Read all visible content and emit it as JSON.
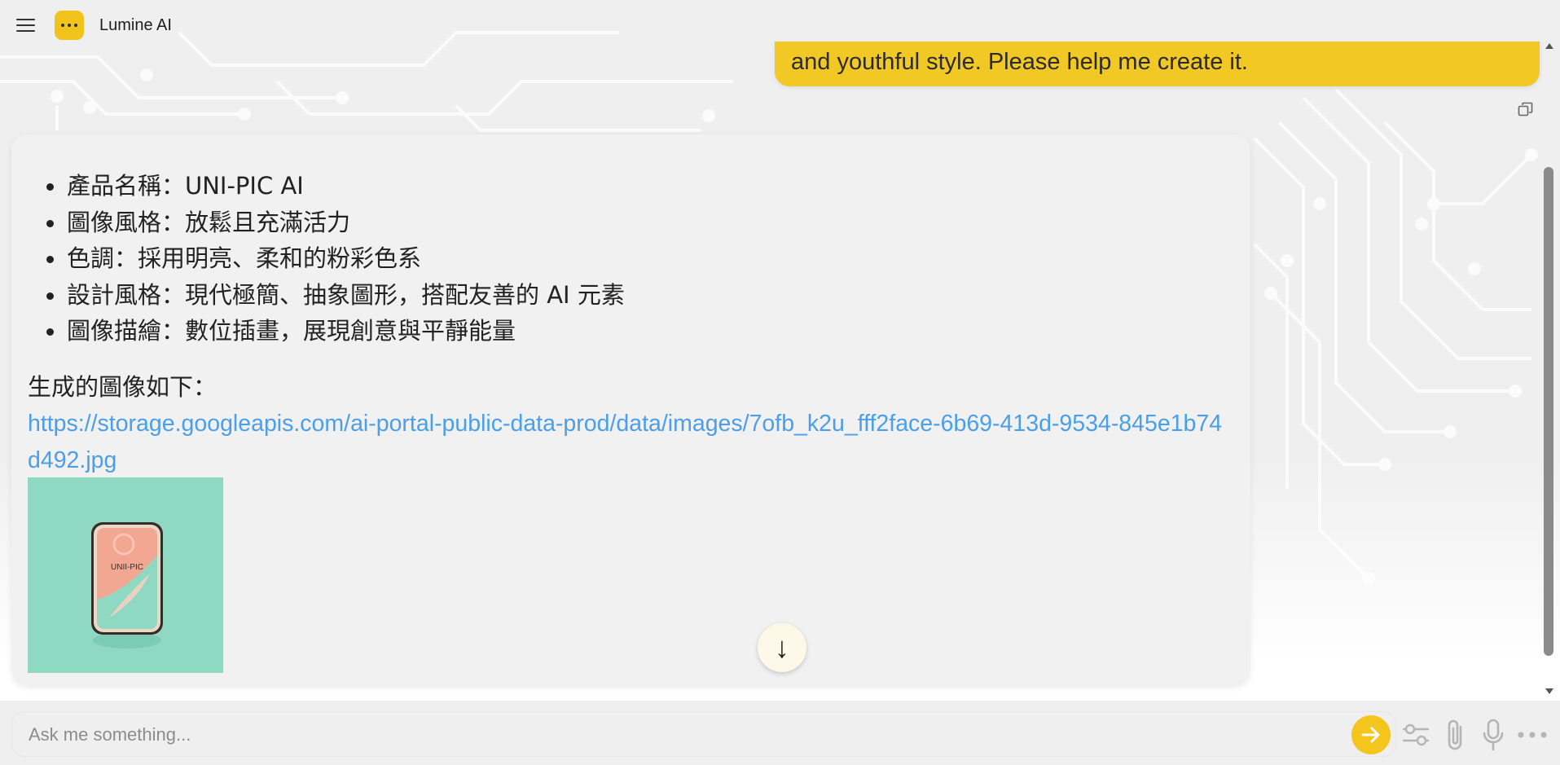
{
  "app": {
    "title": "Lumine AI"
  },
  "user_message": {
    "text": "and youthful style. Please help me create it."
  },
  "assistant_message": {
    "attributes": [
      "產品名稱：UNI-PIC AI",
      "圖像風格：放鬆且充滿活力",
      "色調：採用明亮、柔和的粉彩色系",
      "設計風格：現代極簡、抽象圖形，搭配友善的 AI 元素",
      "圖像描繪：數位插畫，展現創意與平靜能量"
    ],
    "generated_label": "生成的圖像如下：",
    "image_link": "https://storage.googleapis.com/ai-portal-public-data-prod/data/images/7ofb_k2u_fff2face-6b69-413d-9534-845e1b74d492.jpg",
    "image_logo_text": "UNII-PIC"
  },
  "input": {
    "placeholder": "Ask me something..."
  },
  "icons": {
    "menu": "hamburger-menu-icon",
    "logo": "ellipsis-logo-icon",
    "copy": "copy-icon",
    "scroll_down": "arrow-down-icon",
    "send": "arrow-right-icon",
    "settings": "sliders-icon",
    "attach": "paperclip-icon",
    "voice": "microphone-icon",
    "more": "more-dots-icon"
  },
  "colors": {
    "accent": "#f2c824",
    "link": "#4b9fea",
    "background": "#efefef",
    "image_bg": "#8fd9c3"
  }
}
